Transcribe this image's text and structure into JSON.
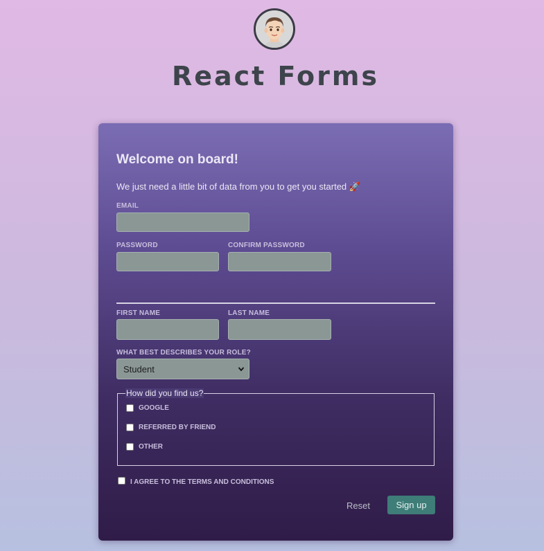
{
  "header": {
    "title": "React Forms",
    "avatar_icon": "avatar-memoji-icon"
  },
  "form": {
    "welcome": "Welcome on board!",
    "subtitle": "We just need a little bit of data from you to get you started 🚀",
    "email": {
      "label": "EMAIL",
      "value": ""
    },
    "password": {
      "label": "PASSWORD",
      "value": ""
    },
    "confirm_password": {
      "label": "CONFIRM PASSWORD",
      "value": ""
    },
    "first_name": {
      "label": "FIRST NAME",
      "value": ""
    },
    "last_name": {
      "label": "LAST NAME",
      "value": ""
    },
    "role": {
      "label": "WHAT BEST DESCRIBES YOUR ROLE?",
      "selected": "Student"
    },
    "source": {
      "legend": "How did you find us?",
      "options": [
        {
          "label": "GOOGLE",
          "checked": false
        },
        {
          "label": "REFERRED BY FRIEND",
          "checked": false
        },
        {
          "label": "OTHER",
          "checked": false
        }
      ]
    },
    "terms": {
      "label": "I AGREE TO THE TERMS AND CONDITIONS",
      "checked": false
    },
    "reset_label": "Reset",
    "signup_label": "Sign up"
  },
  "colors": {
    "primary_button": "#3e7d78",
    "card_top": "#7b6db4",
    "card_bottom": "#301c48",
    "title_text": "#3d444b"
  }
}
